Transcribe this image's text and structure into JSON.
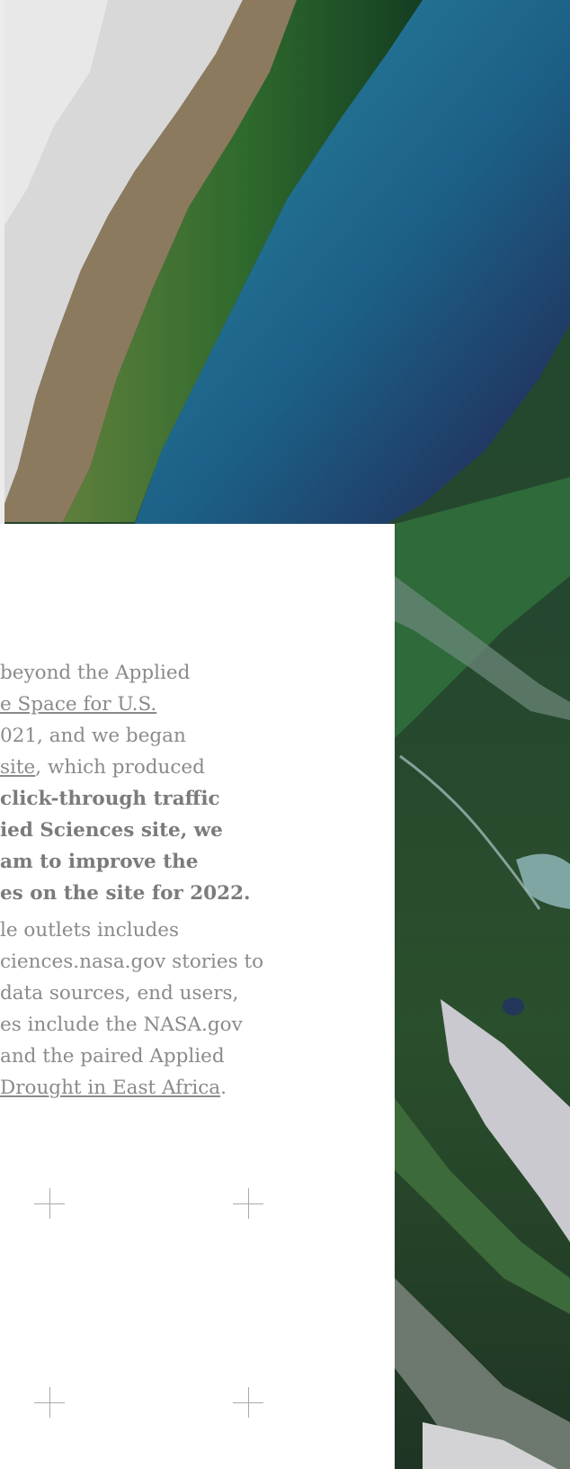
{
  "article": {
    "p1": {
      "l1": "beyond the Applied",
      "l2_link": "e Space for U.S.",
      "l3": "021, and we began",
      "l4_link": "site",
      "l4_rest": ", which produced",
      "l5": "click-through traffic",
      "l6": "ied Sciences site, we",
      "l7": "am to improve the",
      "l8": "es on the site for 2022."
    },
    "p2": {
      "l1": "le outlets includes",
      "l2": "ciences.nasa.gov stories to",
      "l3": "data sources, end users,",
      "l4": "es include the NASA.gov",
      "l5": "and the paired Applied",
      "l6_link": "Drought in East Africa",
      "l6_rest": "."
    }
  },
  "colors": {
    "text": "#8a8a8a",
    "panel": "#ffffff",
    "water": "#1f6d8c"
  },
  "icons": [
    "crosshair-icon",
    "crosshair-icon",
    "crosshair-icon",
    "crosshair-icon"
  ]
}
